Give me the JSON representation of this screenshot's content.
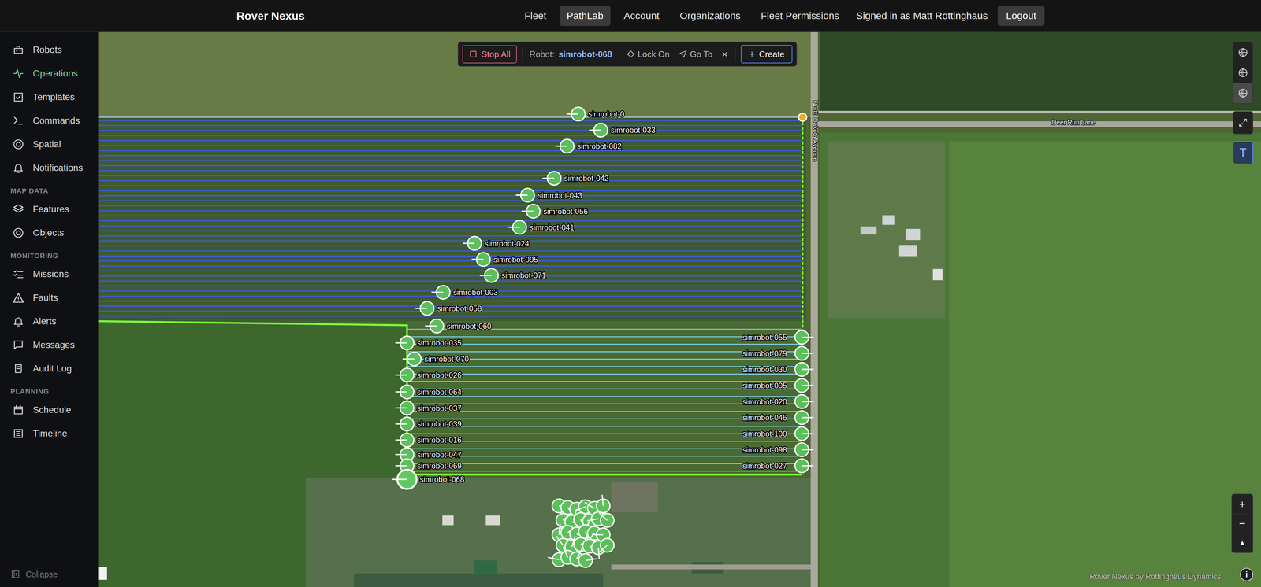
{
  "brand": "Rover Nexus",
  "nav": [
    {
      "label": "Fleet",
      "selected": false
    },
    {
      "label": "PathLab",
      "selected": true
    },
    {
      "label": "Account",
      "selected": false
    },
    {
      "label": "Organizations",
      "selected": false
    },
    {
      "label": "Fleet Permissions",
      "selected": false
    }
  ],
  "user": {
    "signed_in": "Signed in as Matt Rottinghaus",
    "logout": "Logout"
  },
  "sidebar": {
    "items": [
      {
        "label": "Robots",
        "selected": false
      },
      {
        "label": "Operations",
        "selected": true
      },
      {
        "label": "Templates",
        "selected": false
      },
      {
        "label": "Commands",
        "selected": false
      },
      {
        "label": "Spatial",
        "selected": false
      },
      {
        "label": "Notifications",
        "selected": false
      }
    ],
    "sections": [
      {
        "title": "MAP DATA",
        "items": [
          {
            "label": "Features",
            "selected": false
          },
          {
            "label": "Objects",
            "selected": false
          }
        ]
      },
      {
        "title": "MONITORING",
        "items": [
          {
            "label": "Missions",
            "selected": false
          },
          {
            "label": "Faults",
            "selected": false
          },
          {
            "label": "Alerts",
            "selected": false
          },
          {
            "label": "Messages",
            "selected": false
          },
          {
            "label": "Audit Log",
            "selected": false
          }
        ]
      },
      {
        "title": "PLANNING",
        "items": [
          {
            "label": "Schedule",
            "selected": false
          },
          {
            "label": "Timeline",
            "selected": false
          }
        ]
      }
    ],
    "collapse": "Collapse"
  },
  "toolbar": {
    "stop_all": "Stop All",
    "robot_label": "Robot:",
    "robot": "simrobot-068",
    "lock_on": "Lock On",
    "go_to": "Go To",
    "close": "×",
    "create_icon": "+",
    "create": "Create"
  },
  "map": {
    "horizontal_street": "Deer Run Lane",
    "vertical_street": "North Dakota Avenue",
    "robots": [
      {
        "name": "simrobot-0",
        "selected": false
      },
      {
        "name": "simrobot-033",
        "selected": false
      },
      {
        "name": "simrobot-082",
        "selected": false
      },
      {
        "name": "simrobot-042",
        "selected": false
      },
      {
        "name": "simrobot-043",
        "selected": false
      },
      {
        "name": "simrobot-056",
        "selected": false
      },
      {
        "name": "simrobot-041",
        "selected": false
      },
      {
        "name": "simrobot-024",
        "selected": false
      },
      {
        "name": "simrobot-095",
        "selected": false
      },
      {
        "name": "simrobot-071",
        "selected": false
      },
      {
        "name": "simrobot-003",
        "selected": false
      },
      {
        "name": "simrobot-058",
        "selected": false
      },
      {
        "name": "simrobot-060",
        "selected": false
      },
      {
        "name": "simrobot-035",
        "selected": false
      },
      {
        "name": "simrobot-070",
        "selected": false
      },
      {
        "name": "simrobot-026",
        "selected": false
      },
      {
        "name": "simrobot-064",
        "selected": false
      },
      {
        "name": "simrobot-037",
        "selected": false
      },
      {
        "name": "simrobot-039",
        "selected": false
      },
      {
        "name": "simrobot-016",
        "selected": false
      },
      {
        "name": "simrobot-047",
        "selected": false
      },
      {
        "name": "simrobot-069",
        "selected": false
      },
      {
        "name": "simrobot-068",
        "selected": true
      },
      {
        "name": "simrobot-055",
        "selected": false
      },
      {
        "name": "simrobot-079",
        "selected": false
      },
      {
        "name": "simrobot-030",
        "selected": false
      },
      {
        "name": "simrobot-005",
        "selected": false
      },
      {
        "name": "simrobot-020",
        "selected": false
      },
      {
        "name": "simrobot-046",
        "selected": false
      },
      {
        "name": "simrobot-100",
        "selected": false
      },
      {
        "name": "simrobot-098",
        "selected": false
      },
      {
        "name": "simrobot-027",
        "selected": false
      }
    ],
    "layers": [
      {
        "selected": false
      },
      {
        "selected": false
      },
      {
        "selected": true
      }
    ],
    "text_tool": {
      "label": "T",
      "selected": true
    },
    "zoom": [
      "+",
      "−",
      "▲"
    ],
    "attribution": "Rover Nexus by Rottinghaus Dynamics",
    "info": "i"
  }
}
